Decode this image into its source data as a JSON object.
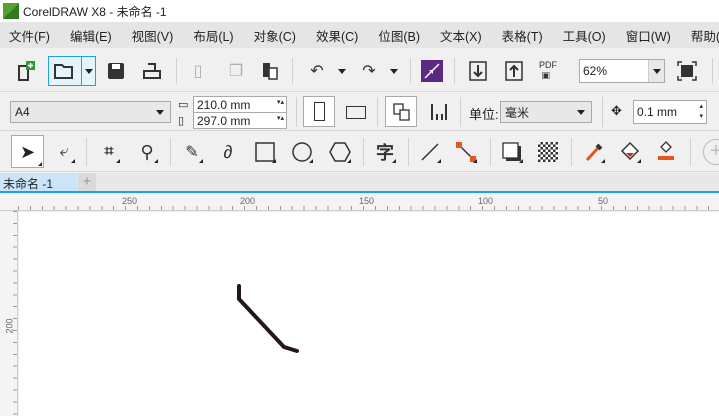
{
  "window": {
    "title": "CorelDRAW X8 - 未命名 -1"
  },
  "menu": [
    "文件(F)",
    "编辑(E)",
    "视图(V)",
    "布局(L)",
    "对象(C)",
    "效果(C)",
    "位图(B)",
    "文本(X)",
    "表格(T)",
    "工具(O)",
    "窗口(W)",
    "帮助(H)"
  ],
  "toolbar": {
    "zoom_value": "62%",
    "pdf_label": "PDF"
  },
  "property_bar": {
    "page_size": "A4",
    "width": "210.0 mm",
    "height": "297.0 mm",
    "units_label": "单位:",
    "units_value": "毫米",
    "nudge": "0.1 mm"
  },
  "toolbox": {
    "text_tool_glyph": "字"
  },
  "tabs": [
    {
      "label": "未命名 -1",
      "active": true
    }
  ],
  "ruler": {
    "top_labels": [
      "250",
      "200",
      "150",
      "100",
      "50"
    ],
    "left_labels": [
      "200"
    ]
  },
  "colors": {
    "accent": "#1ea0e6",
    "tab_active": "#cce4f7",
    "stroke": "#231815"
  }
}
